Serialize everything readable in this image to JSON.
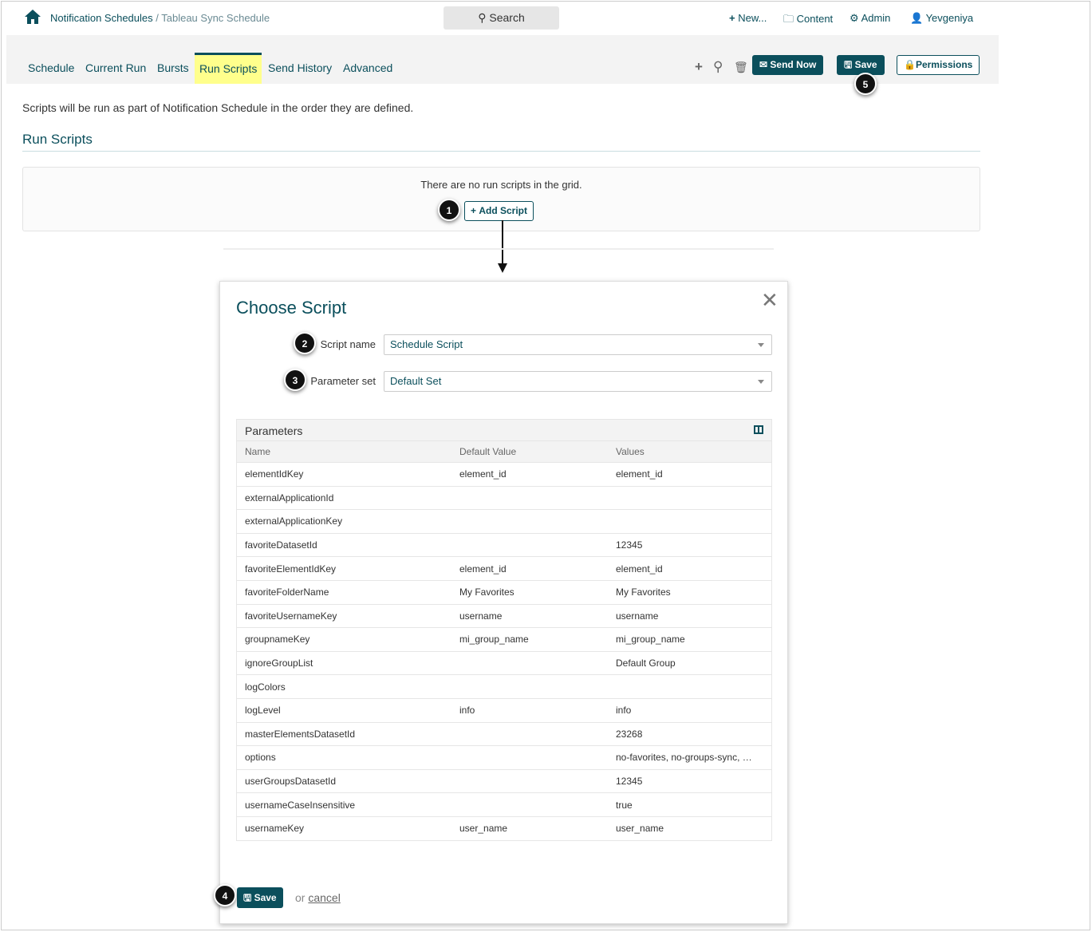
{
  "header": {
    "breadcrumb_parent": "Notification Schedules",
    "breadcrumb_sep": " / ",
    "breadcrumb_current": "Tableau Sync Schedule",
    "search": "Search",
    "new": "New...",
    "content": "Content",
    "admin": "Admin",
    "user": "Yevgeniya"
  },
  "tabs": [
    "Schedule",
    "Current Run",
    "Bursts",
    "Run Scripts",
    "Send History",
    "Advanced"
  ],
  "toolbar": {
    "send_now": "Send Now",
    "save": "Save",
    "permissions": "Permissions"
  },
  "page": {
    "intro": "Scripts will be run as part of Notification Schedule in the order they are defined.",
    "section": "Run Scripts",
    "empty": "There are no run scripts in the grid.",
    "add_script": "Add Script"
  },
  "badges": [
    "1",
    "2",
    "3",
    "4",
    "5"
  ],
  "modal": {
    "title": "Choose Script",
    "script_label": "Script name",
    "script_value": "Schedule Script",
    "param_label": "Parameter set",
    "param_value": "Default Set",
    "grid_title": "Parameters",
    "columns": [
      "Name",
      "Default Value",
      "Values"
    ],
    "rows": [
      [
        "elementIdKey",
        "element_id",
        "element_id"
      ],
      [
        "externalApplicationId",
        "",
        ""
      ],
      [
        "externalApplicationKey",
        "",
        ""
      ],
      [
        "favoriteDatasetId",
        "",
        "12345"
      ],
      [
        "favoriteElementIdKey",
        "element_id",
        "element_id"
      ],
      [
        "favoriteFolderName",
        "My Favorites",
        "My Favorites"
      ],
      [
        "favoriteUsernameKey",
        "username",
        "username"
      ],
      [
        "groupnameKey",
        "mi_group_name",
        "mi_group_name"
      ],
      [
        "ignoreGroupList",
        "",
        "Default Group"
      ],
      [
        "logColors",
        "",
        ""
      ],
      [
        "logLevel",
        "info",
        "info"
      ],
      [
        "masterElementsDatasetId",
        "",
        "23268"
      ],
      [
        "options",
        "",
        "no-favorites, no-groups-sync, …"
      ],
      [
        "userGroupsDatasetId",
        "",
        "12345"
      ],
      [
        "usernameCaseInsensitive",
        "",
        "true"
      ],
      [
        "usernameKey",
        "user_name",
        "user_name"
      ]
    ],
    "save": "Save",
    "or": "or",
    "cancel": "cancel"
  }
}
